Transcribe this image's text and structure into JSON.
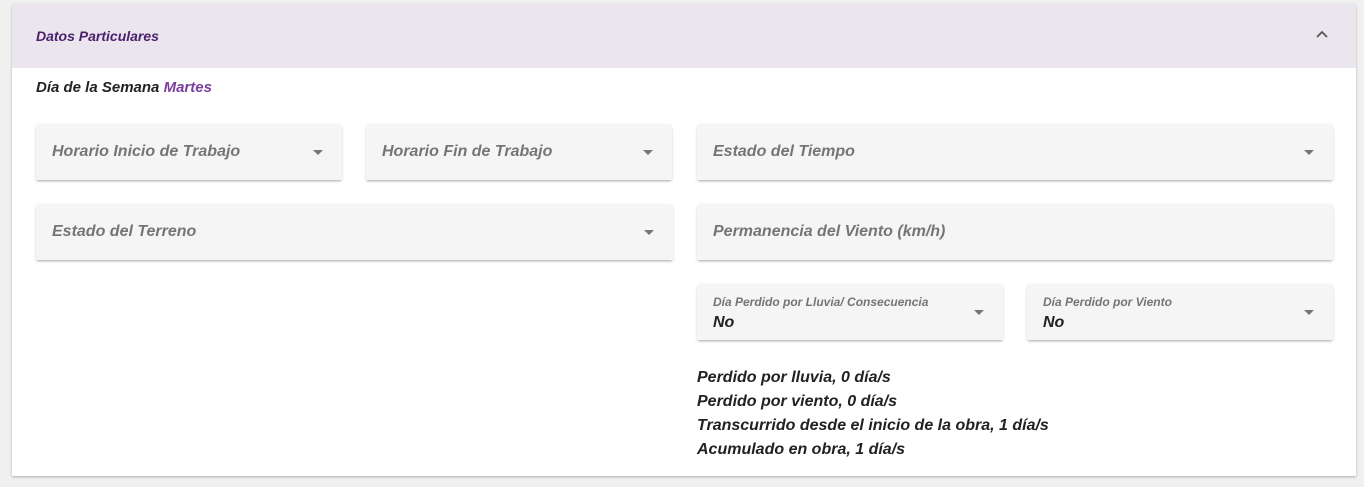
{
  "panel": {
    "title": "Datos Particulares",
    "collapse_icon": "chevron-up-icon"
  },
  "weekday": {
    "label": "Día de la Semana",
    "value": "Martes"
  },
  "fields": {
    "horario_inicio": {
      "label": "Horario Inicio de Trabajo",
      "icon": "dropdown-arrow-icon"
    },
    "horario_fin": {
      "label": "Horario Fin de Trabajo",
      "icon": "dropdown-arrow-icon"
    },
    "estado_tiempo": {
      "label": "Estado del Tiempo",
      "icon": "dropdown-arrow-icon"
    },
    "estado_terreno": {
      "label": "Estado del Terreno",
      "icon": "dropdown-arrow-icon"
    },
    "permanencia_viento": {
      "placeholder": "Permanencia del Viento (km/h)"
    },
    "dia_perdido_lluvia": {
      "label": "Día Perdido por Lluvia/ Consecuencia",
      "value": "No",
      "icon": "dropdown-arrow-icon"
    },
    "dia_perdido_viento": {
      "label": "Día Perdido por Viento",
      "value": "No",
      "icon": "dropdown-arrow-icon"
    }
  },
  "summary": {
    "lluvia": "Perdido por lluvia, 0 día/s",
    "viento": "Perdido por viento, 0 día/s",
    "transcurrido": "Transcurrido desde el inicio de la obra, 1 día/s",
    "acumulado": "Acumulado en obra, 1 día/s"
  },
  "colors": {
    "header_bg": "#ebe5ed",
    "title": "#4a1f6e",
    "accent": "#7a3f9e",
    "field_bg": "#f5f5f5"
  }
}
